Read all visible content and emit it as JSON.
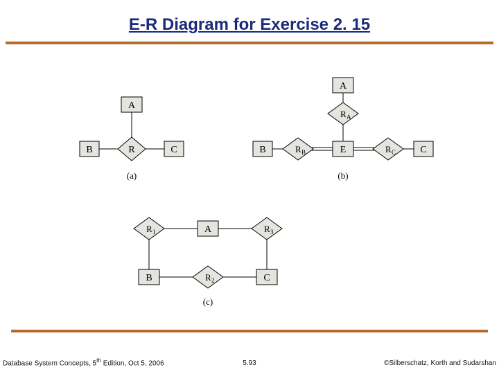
{
  "title": "E-R Diagram for Exercise 2. 15",
  "footer": {
    "left_a": "Database System Concepts, 5",
    "left_sup": "th",
    "left_b": " Edition, Oct 5, 2006",
    "mid": "5.93",
    "right": "©Silberschatz, Korth and Sudarshan"
  },
  "diag": {
    "a": {
      "A": "A",
      "B": "B",
      "C": "C",
      "R": "R",
      "label": "(a)"
    },
    "b": {
      "A": "A",
      "B": "B",
      "C": "C",
      "E": "E",
      "RA": "R",
      "RA_sub": "A",
      "RB": "R",
      "RB_sub": "B",
      "RC": "R",
      "RC_sub": "C",
      "label": "(b)"
    },
    "c": {
      "A": "A",
      "B": "B",
      "C": "C",
      "R1": "R",
      "R1_sub": "1",
      "R2": "R",
      "R2_sub": "2",
      "R3": "R",
      "R3_sub": "3",
      "label": "(c)"
    }
  }
}
